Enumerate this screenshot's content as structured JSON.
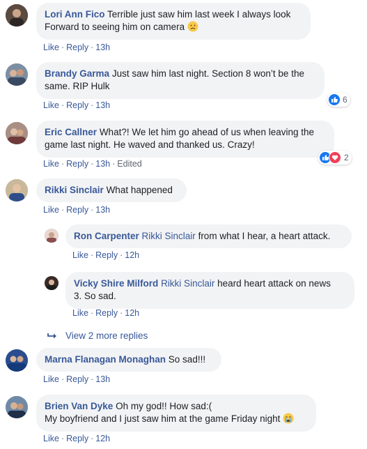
{
  "comments": [
    {
      "author": "Lori Ann Fico",
      "text_line1": "Terrible just saw him last week I always look",
      "text_line2": "Forward to seeing him on camera",
      "like": "Like",
      "reply": "Reply",
      "time": "13h",
      "emoji": "sad-face-icon"
    },
    {
      "author": "Brandy Garma",
      "text_line1": "Just saw him last night. Section 8 won’t be the",
      "text_line2": "same. RIP Hulk",
      "like": "Like",
      "reply": "Reply",
      "time": "13h",
      "reaction_count": "6"
    },
    {
      "author": "Eric Callner",
      "text_line1": "What?! We let him go ahead of us when leaving the",
      "text_line2": "game last night. He waved and thanked us. Crazy!",
      "like": "Like",
      "reply": "Reply",
      "time": "13h",
      "edited": "Edited",
      "reaction_count": "2"
    },
    {
      "author": "Rikki Sinclair",
      "text_line1": "What happened",
      "like": "Like",
      "reply": "Reply",
      "time": "13h"
    }
  ],
  "replies": [
    {
      "author": "Ron Carpenter",
      "mention": "Rikki Sinclair",
      "text_line1": "from what I hear, a heart attack.",
      "like": "Like",
      "reply": "Reply",
      "time": "12h"
    },
    {
      "author": "Vicky Shire Milford",
      "mention": "Rikki Sinclair",
      "text_line1": "heard heart attack on news",
      "text_line2": "3. So sad.",
      "like": "Like",
      "reply": "Reply",
      "time": "12h"
    }
  ],
  "view_more_replies": "View 2 more replies",
  "comments_after": [
    {
      "author": "Marna Flanagan Monaghan",
      "text_line1": "So sad!!!",
      "like": "Like",
      "reply": "Reply",
      "time": "13h"
    },
    {
      "author": "Brien Van Dyke",
      "text_line1": "Oh my god!! How sad:(",
      "text_line2": "My boyfriend and I just saw him at the game Friday night",
      "like": "Like",
      "reply": "Reply",
      "time": "12h",
      "emoji": "crying-face-icon"
    }
  ],
  "colors": {
    "link": "#385898",
    "bubble": "#f2f3f5",
    "meta": "#606770",
    "like_reaction": "#1877f2",
    "love_reaction": "#f33e58"
  }
}
